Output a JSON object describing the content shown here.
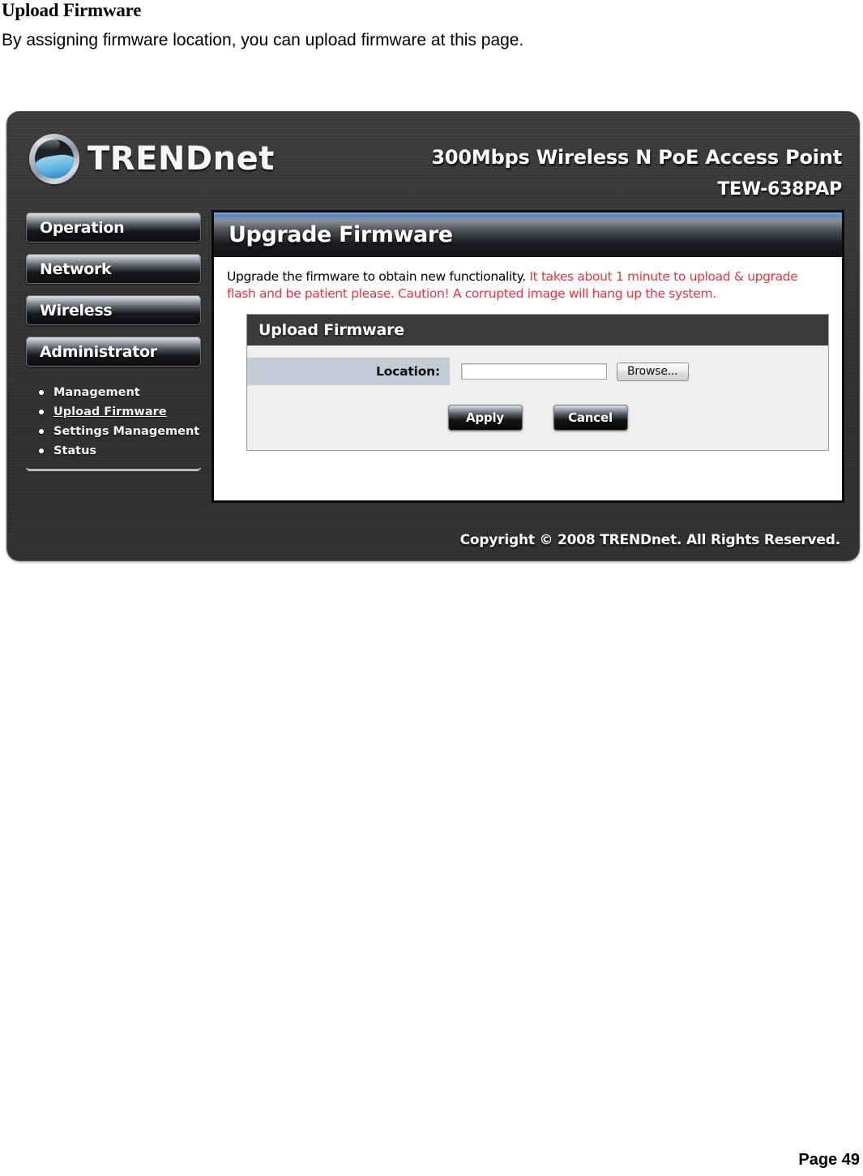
{
  "document": {
    "title": "Upload Firmware",
    "intro": "By assigning firmware location, you can upload firmware at this page.",
    "page_label": "Page  49"
  },
  "device": {
    "brand": {
      "name_upper": "TREND",
      "name_lower": "net",
      "logo_icon": "trendnet-circle-wave-logo"
    },
    "product": {
      "line1": "300Mbps Wireless N PoE Access Point",
      "line2": "TEW-638PAP"
    },
    "sidebar": {
      "buttons": [
        {
          "label": "Operation"
        },
        {
          "label": "Network"
        },
        {
          "label": "Wireless"
        },
        {
          "label": "Administrator"
        }
      ],
      "submenu": [
        {
          "label": "Management",
          "active": false
        },
        {
          "label": "Upload Firmware",
          "active": true
        },
        {
          "label": "Settings Management",
          "active": false
        },
        {
          "label": "Status",
          "active": false
        }
      ]
    },
    "content": {
      "title": "Upgrade Firmware",
      "description_normal": "Upgrade the firmware to obtain new functionality. ",
      "description_warning": "It takes about 1 minute to upload & upgrade flash and be patient please. Caution! A corrupted image will hang up the system.",
      "panel": {
        "header": "Upload Firmware",
        "field_label": "Location:",
        "field_value": "",
        "field_placeholder": "",
        "browse_label": "Browse...",
        "apply_label": "Apply",
        "cancel_label": "Cancel"
      }
    },
    "footer": "Copyright © 2008 TRENDnet. All Rights Reserved.",
    "colors": {
      "shell": "#333333",
      "accent_blue": "#5b86bd",
      "warning_red": "#e8353f",
      "field_label_bg": "#c2ccd7",
      "panel_bg": "#efefef"
    }
  }
}
